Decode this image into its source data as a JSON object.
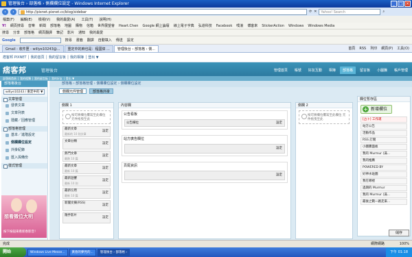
{
  "browser": {
    "title": "管理後台 › 部落格 › 側欄欄位設定 - Windows Internet Explorer",
    "address": "http://pixnet.pixnet.cc/blog/sidebar",
    "search_placeholder": "Yahoo! Search",
    "menu": [
      "檔案(F)",
      "編輯(E)",
      "檢視(V)",
      "我的最愛(A)",
      "工具(T)",
      "說明(H)"
    ],
    "toolbar1": [
      "網頁搜尋",
      "音樂",
      "新聞",
      "部落格",
      "地圖",
      "購物",
      "信箱",
      "世界展望會",
      "Heart.Chen",
      "Google 網上論壇",
      "線上電子字典",
      "弘道科技",
      "Facebook",
      "噗浪",
      "博客來",
      "StickerAction",
      "Windows",
      "Windows Media"
    ],
    "toolbar2": [
      "搜尋",
      "分享",
      "部落格",
      "網頁翻譯",
      "筆記",
      "影片",
      "通知",
      "我的最愛"
    ],
    "toolbar3": [
      "搜尋",
      "書籤",
      "翻譯",
      "自動填入",
      "傳送",
      "設定"
    ],
    "status_zoom": "100%",
    "status_zone": "網際網路",
    "status_left": "完成"
  },
  "tabs": [
    {
      "label": "Gmail - 收件匣 - willye10243@..."
    },
    {
      "label": "重定中的麻也是：程國偉 ..."
    },
    {
      "label": "管理後台 › 部落格 › 側..."
    }
  ],
  "tab_tools": [
    "首頁",
    "RSS",
    "列印",
    "網頁(P)",
    "工具(O)"
  ],
  "pix_bar": "痞客邦 PIXNET │ 我的首頁 │ 我的留言板 │ 我的相簿 │ 登出 ▼",
  "site": {
    "logo": "痞客邦",
    "logo_sub": "管理後台",
    "nav": [
      "管理首頁",
      "帳號",
      "好友互動",
      "相簿",
      "部落格",
      "留言板",
      "小圖騰",
      "帳戶管理"
    ],
    "active_nav": "部落格",
    "subbar": "部落格首頁  │  我的相簿  │  我的留言板  │  我的好友  │  登出 ▼"
  },
  "sidebar": {
    "header": "部落格後台",
    "selector": "willye10243 / 重定中的 ▼",
    "sections": [
      {
        "title": "文章管理",
        "items": [
          "發表文章",
          "文章列表",
          "隱藏／回應管理"
        ]
      },
      {
        "title": "部落格管理",
        "items": [
          "基本／進階設定",
          "側欄欄位設定",
          "外掛紀錄",
          "匯入與備份"
        ]
      },
      {
        "title": "樣式管理",
        "items": []
      }
    ],
    "ad": {
      "title": "想看微位大明",
      "subtitle": "按下按鈕來看新春影音！"
    }
  },
  "breadcrumb": "部落格 › 部落格管理 › 側欄欄位設定 › 側欄欄位設定",
  "page_tabs": [
    "側欄元件管理",
    "部落格外掛"
  ],
  "col1": {
    "title": "側欄 1",
    "placeholder": "按可將欄位覆寫至此欄位 元件拖曳至此",
    "widgets": [
      {
        "title": "最新文章",
        "sub": "最新的 10 則文章",
        "btn": "設定"
      },
      {
        "title": "文章分類",
        "sub": "",
        "btn": "設定"
      },
      {
        "title": "熱門文章",
        "sub": "最熱 10 篇",
        "btn": "設定"
      },
      {
        "title": "最新文章",
        "sub": "最新 10 篇",
        "btn": "設定"
      },
      {
        "title": "最新迴響",
        "sub": "最新 10 則",
        "btn": "設定"
      },
      {
        "title": "最新引用",
        "sub": "最新 10 篇",
        "btn": "設定"
      },
      {
        "title": "新聞文摘(RSS)",
        "sub": "",
        "btn": "設定"
      },
      {
        "title": "隨手影片",
        "sub": "",
        "btn": "設定"
      }
    ]
  },
  "col_mid": {
    "title": "內容欄",
    "sections": [
      {
        "title": "公告看板",
        "bar": "公告欄位",
        "btn": "設定"
      },
      {
        "title": "站方廣告欄位",
        "bar": "",
        "btn": "設定"
      },
      {
        "title": "頁尾資訊",
        "bar": "",
        "btn": "設定"
      }
    ]
  },
  "col2": {
    "title": "側欄 2",
    "placeholder": "按可將欄位覆寫至此欄位 元件拖曳至此"
  },
  "right": {
    "title": "欄位暫存區",
    "add_label": "新增欄位",
    "items": [
      "[占卜] 工作運",
      "站方公告",
      "活動作品",
      "RSS 訂閱",
      "小圖騰面板",
      "我的 Murmur (滿...",
      "我的推薦",
      "POWERED BY",
      "好神水貼圖",
      "我在哪裡",
      "過期的 Murmur",
      "我的 Murmur (滿...",
      "最後之戰一路走來..."
    ]
  },
  "save_button": "儲存",
  "taskbar": {
    "start": "開始",
    "buttons": [
      "Windows Live Messe...",
      "黃昏的夢見的...",
      "管理後台 › 部落格 ›"
    ],
    "clock": "下午 01:18"
  }
}
